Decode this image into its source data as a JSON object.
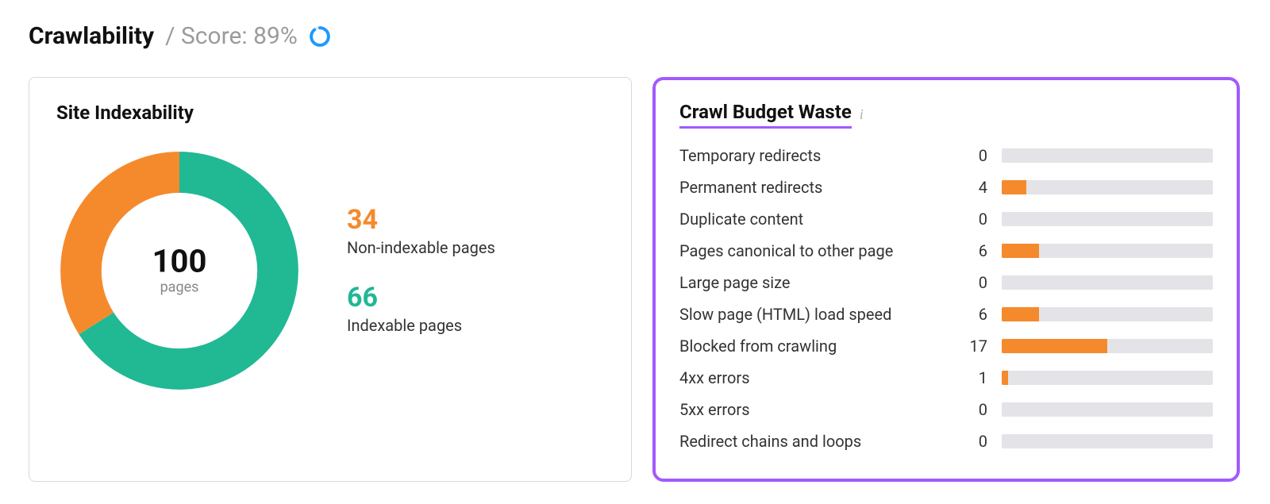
{
  "header": {
    "title": "Crawlability",
    "score_prefix": "/ Score: ",
    "score_value": "89%"
  },
  "indexability": {
    "title": "Site Indexability",
    "total_value": "100",
    "total_label": "pages",
    "non_indexable_value": "34",
    "non_indexable_label": "Non-indexable pages",
    "indexable_value": "66",
    "indexable_label": "Indexable pages"
  },
  "budget": {
    "title": "Crawl Budget Waste",
    "items": [
      {
        "label": "Temporary redirects",
        "value": 0
      },
      {
        "label": "Permanent redirects",
        "value": 4
      },
      {
        "label": "Duplicate content",
        "value": 0
      },
      {
        "label": "Pages canonical to other page",
        "value": 6
      },
      {
        "label": "Large page size",
        "value": 0
      },
      {
        "label": "Slow page (HTML) load speed",
        "value": 6
      },
      {
        "label": "Blocked from crawling",
        "value": 17
      },
      {
        "label": "4xx errors",
        "value": 1
      },
      {
        "label": "5xx errors",
        "value": 0
      },
      {
        "label": "Redirect chains and loops",
        "value": 0
      }
    ]
  },
  "chart_data": [
    {
      "type": "pie",
      "title": "Site Indexability",
      "series": [
        {
          "name": "Non-indexable pages",
          "value": 34,
          "color": "#f58a2c"
        },
        {
          "name": "Indexable pages",
          "value": 66,
          "color": "#21b894"
        }
      ],
      "total_label": "pages",
      "total_value": 100
    },
    {
      "type": "bar",
      "title": "Crawl Budget Waste",
      "categories": [
        "Temporary redirects",
        "Permanent redirects",
        "Duplicate content",
        "Pages canonical to other page",
        "Large page size",
        "Slow page (HTML) load speed",
        "Blocked from crawling",
        "4xx errors",
        "5xx errors",
        "Redirect chains and loops"
      ],
      "values": [
        0,
        4,
        0,
        6,
        0,
        6,
        17,
        1,
        0,
        0
      ],
      "xlabel": "",
      "ylabel": "",
      "ylim": [
        0,
        34
      ]
    }
  ],
  "colors": {
    "orange": "#f58a2c",
    "green": "#21b894",
    "bar_track": "#e4e3e8",
    "highlight_border": "#a259ff",
    "score_ring_blue": "#1e98ff"
  }
}
